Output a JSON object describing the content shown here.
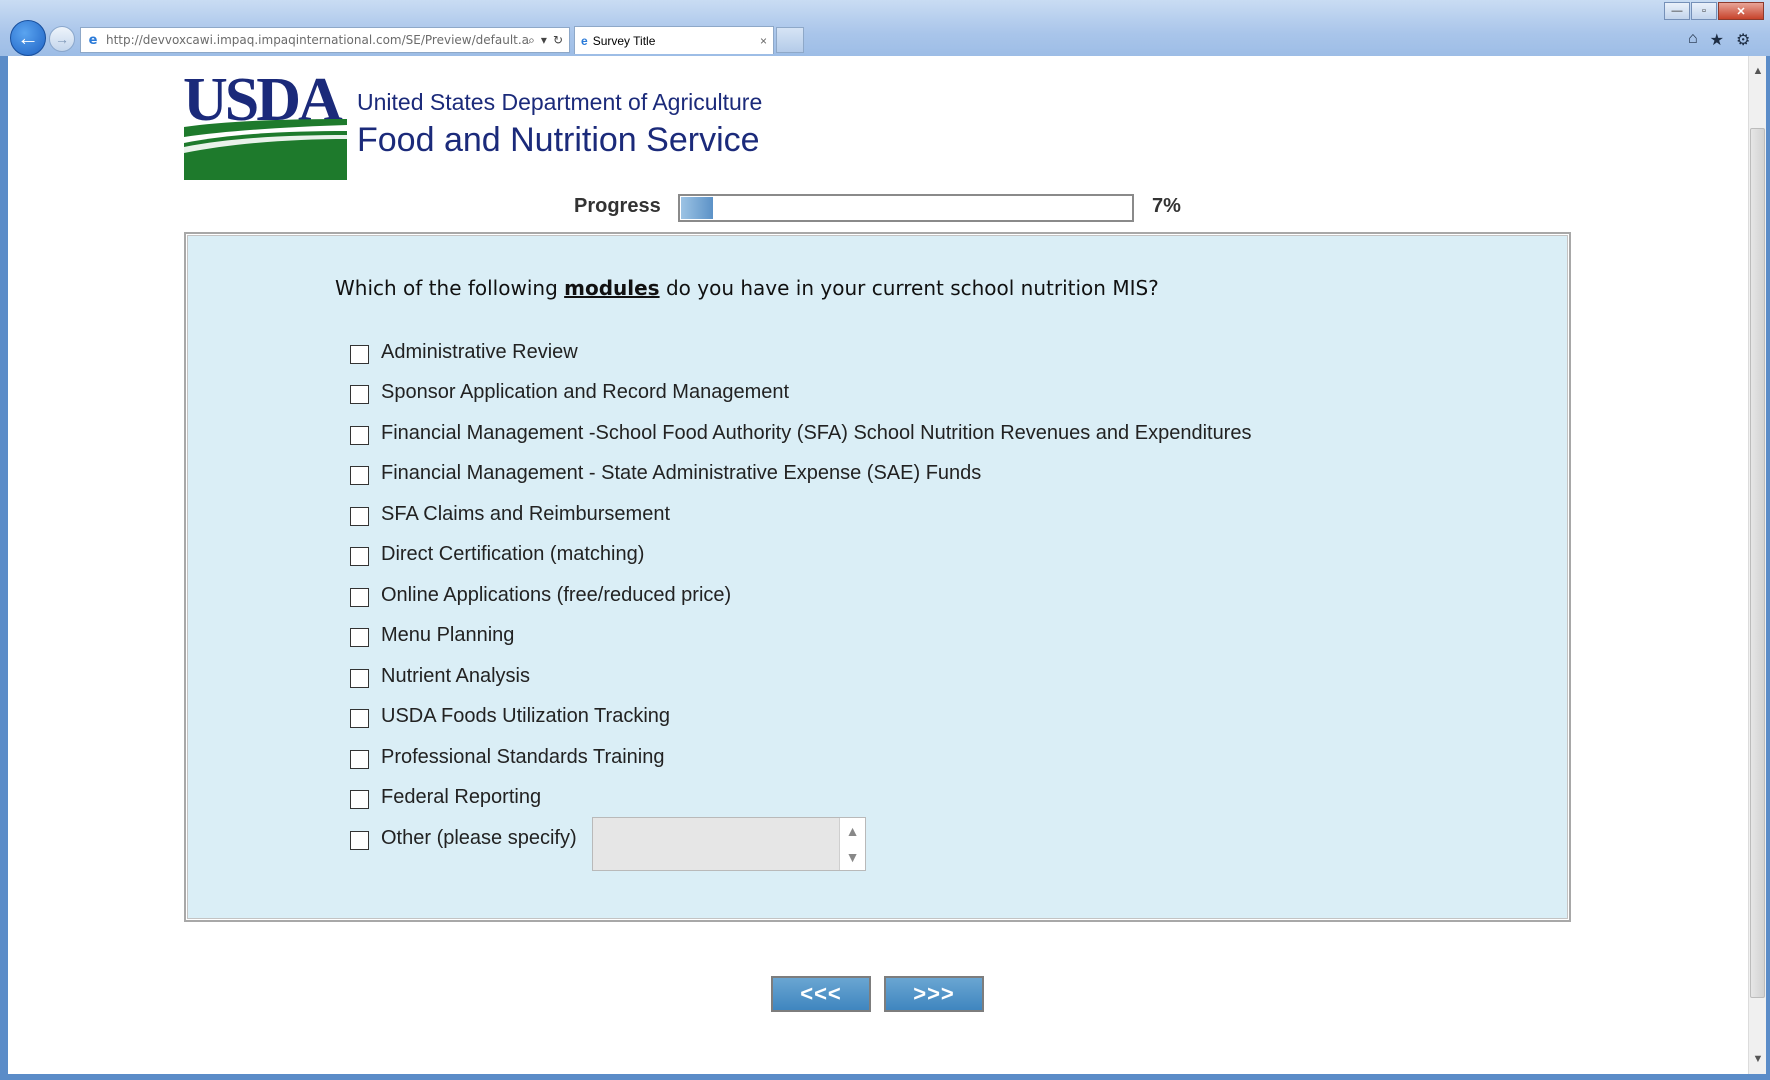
{
  "browser": {
    "address_url": "http://devvoxcawi.impaq.impaqinternational.com/SE/Preview/default.aspx",
    "tab_title": "Survey Title",
    "tab_close": "×",
    "back_glyph": "←",
    "forward_glyph": "→",
    "search_glyph": "⌕",
    "dropdown_glyph": "▾",
    "refresh_glyph": "↻",
    "min_glyph": "—",
    "max_glyph": "▫",
    "close_glyph": "✕",
    "home_glyph": "⌂",
    "favorites_glyph": "★",
    "tools_glyph": "⚙",
    "icons": [
      "back-arrow-icon",
      "forward-arrow-icon",
      "ie-page-icon",
      "search-icon",
      "dropdown-icon",
      "refresh-icon",
      "home-icon",
      "favorites-star-icon",
      "tools-gear-icon"
    ]
  },
  "header": {
    "logo_text": "USDA",
    "agency_line1": "United States Department of Agriculture",
    "agency_line2": "Food and Nutrition Service",
    "brand_blue": "#1b2a7a",
    "brand_green": "#1e7a2c"
  },
  "progress": {
    "label": "Progress",
    "percent_text": "7%",
    "value": 0.07
  },
  "question": {
    "text_before": "Which of the following ",
    "text_emphasis": "modules",
    "text_after": " do you have in your current school nutrition MIS?",
    "panel_color": "#daeef6"
  },
  "options": [
    {
      "label": "Administrative Review",
      "checked": false
    },
    {
      "label": "Sponsor Application and Record Management",
      "checked": false
    },
    {
      "label": "Financial Management -School Food Authority (SFA) School Nutrition Revenues and Expenditures",
      "checked": false
    },
    {
      "label": "Financial Management - State Administrative Expense (SAE) Funds",
      "checked": false
    },
    {
      "label": "SFA Claims and Reimbursement",
      "checked": false
    },
    {
      "label": "Direct Certification (matching)",
      "checked": false
    },
    {
      "label": "Online Applications (free/reduced price)",
      "checked": false
    },
    {
      "label": "Menu Planning",
      "checked": false
    },
    {
      "label": "Nutrient Analysis",
      "checked": false
    },
    {
      "label": "USDA Foods Utilization Tracking",
      "checked": false
    },
    {
      "label": "Professional Standards Training",
      "checked": false
    },
    {
      "label": "Federal Reporting",
      "checked": false
    },
    {
      "label": "Other (please specify)",
      "checked": false
    }
  ],
  "other_specify": {
    "value": "",
    "spin_up": "▲",
    "spin_down": "▼"
  },
  "navigation": {
    "prev_label": "<<<",
    "next_label": ">>>",
    "button_color": "#4a8cc4"
  }
}
